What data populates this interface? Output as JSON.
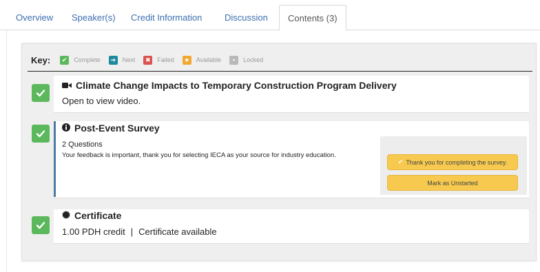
{
  "tabs": [
    "Overview",
    "Speaker(s)",
    "Credit Information",
    "Discussion",
    "Contents (3)"
  ],
  "key": {
    "title": "Key:",
    "items": [
      {
        "label": "Complete",
        "symbol": "✔",
        "color": "#5cb85c"
      },
      {
        "label": "Next",
        "symbol": "➔",
        "color": "#1f8a9c"
      },
      {
        "label": "Failed",
        "symbol": "✖",
        "color": "#d9534f"
      },
      {
        "label": "Available",
        "symbol": "★",
        "color": "#f0a830"
      },
      {
        "label": "Locked",
        "symbol": "▪",
        "color": "#b9b9b9"
      }
    ]
  },
  "items": [
    {
      "icon": "video-camera-icon",
      "title": "Climate Change Impacts to Temporary Construction Program Delivery",
      "subtitle": "Open to view video.",
      "status": "Complete"
    },
    {
      "icon": "info-icon",
      "title": "Post-Event Survey",
      "count": "2 Questions",
      "description": "Your feedback is important, thank you for selecting IECA as your source for industry education.",
      "status": "Complete",
      "done_button": "Thank you for completing the survey.",
      "unstart_button": "Mark as Unstarted"
    },
    {
      "icon": "certificate-icon",
      "title": "Certificate",
      "credit": "1.00 PDH credit",
      "separator": "|",
      "cert_status": "Certificate available",
      "status": "Complete"
    }
  ],
  "colors": {
    "complete": "#5cb85c",
    "tab_link": "#3d6fb0",
    "survey_button": "#f7ca4f",
    "accent_bar": "#4a7ba6"
  }
}
